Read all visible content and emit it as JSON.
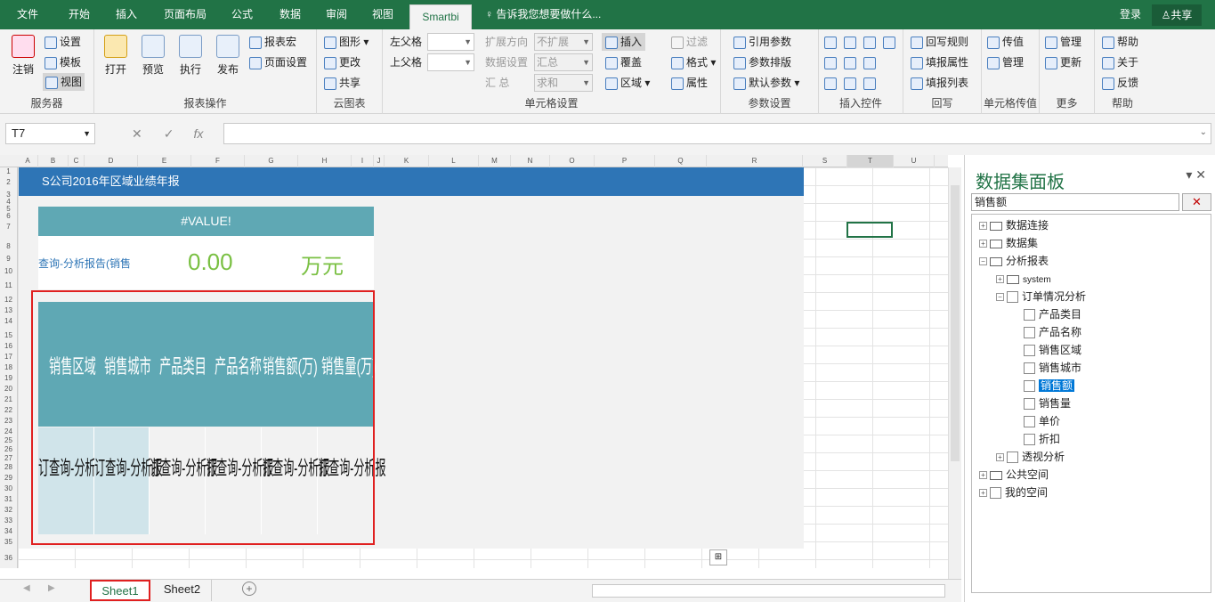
{
  "tabs": [
    "文件",
    "开始",
    "插入",
    "页面布局",
    "公式",
    "数据",
    "审阅",
    "视图",
    "Smartbi"
  ],
  "tell_me": "告诉我您想要做什么...",
  "login": "登录",
  "share": "共享",
  "groups": {
    "server": "服务器",
    "report_ops": "报表操作",
    "cloud": "云图表",
    "cell_settings": "单元格设置",
    "param_settings": "参数设置",
    "insert_ctrl": "插入控件",
    "writeback": "回写",
    "cell_pass": "单元格传值",
    "more": "更多",
    "help": "帮助"
  },
  "btns": {
    "logout": "注销",
    "settings": "设置",
    "template": "模板",
    "view": "视图",
    "open": "打开",
    "preview": "预览",
    "execute": "执行",
    "publish": "发布",
    "report_macro": "报表宏",
    "page_setup": "页面设置",
    "chart": "图形",
    "update": "更改",
    "share": "共享",
    "left_parent": "左父格",
    "upper_parent": "上父格",
    "expand_dir": "扩展方向",
    "no_expand": "不扩展",
    "data_settings": "数据设置",
    "summary": "汇 总",
    "summary_val": "汇总",
    "sum": "求和",
    "insert": "插入",
    "cover": "覆盖",
    "region": "区域",
    "filter": "过滤",
    "format": "格式",
    "property": "属性",
    "ref_param": "引用参数",
    "param_layout": "参数排版",
    "default_param": "默认参数",
    "wb_rule": "回写规则",
    "fill_prop": "填报属性",
    "fill_list": "填报列表",
    "pass_value": "传值",
    "manage": "管理",
    "manage2": "管理",
    "refresh": "更新",
    "help": "帮助",
    "about": "关于",
    "feedback": "反馈"
  },
  "name_box": "T7",
  "report": {
    "title": "S公司2016年区域业绩年报",
    "value_error": "#VALUE!",
    "kpi_label": "查询-分析报告(销售",
    "kpi_value": "0.00",
    "kpi_unit": "万元",
    "headers": [
      "销售区域",
      "销售城市",
      "产品类目",
      "产品名称",
      "销售额(万)",
      "销售量(万)"
    ],
    "cells": [
      "订查询-分析报",
      "订查询-分析报",
      "订查询-分析报",
      "订查询-分析报",
      "订查询-分析报",
      "订查询-分析报"
    ]
  },
  "sheets": [
    "Sheet1",
    "Sheet2"
  ],
  "panel": {
    "title": "数据集面板",
    "search": "销售额",
    "tree": [
      "数据连接",
      "数据集",
      "分析报表",
      "system",
      "订单情况分析",
      "产品类目",
      "产品名称",
      "销售区域",
      "销售城市",
      "销售额",
      "销售量",
      "单价",
      "折扣",
      "透视分析",
      "公共空间",
      "我的空间"
    ]
  }
}
